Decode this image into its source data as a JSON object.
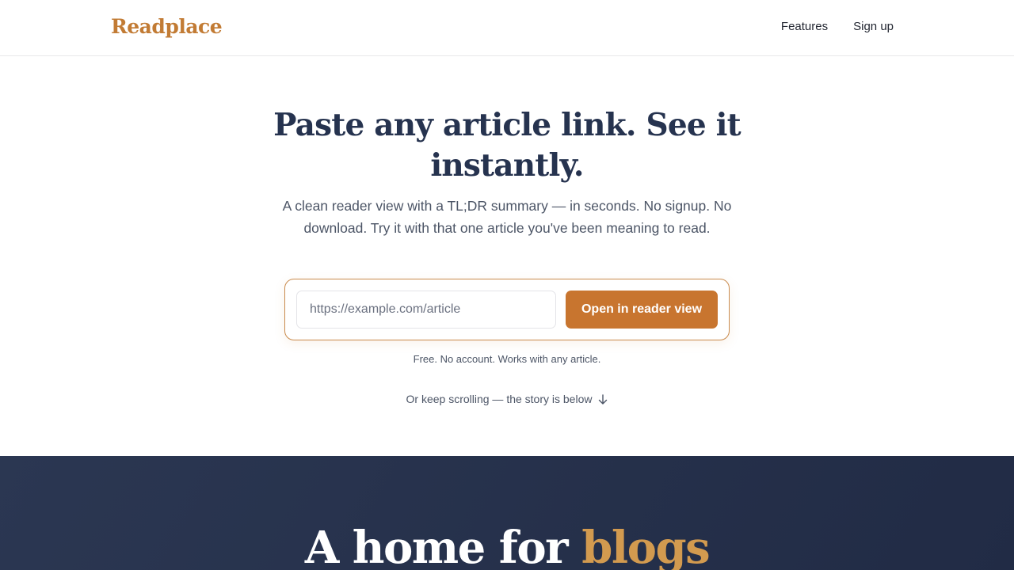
{
  "header": {
    "logo": "Readplace",
    "nav": [
      {
        "label": "Features"
      },
      {
        "label": "Sign up"
      }
    ]
  },
  "hero": {
    "title": "Paste any article link. See it instantly.",
    "subtitle": "A clean reader view with a TL;DR summary — in seconds. No signup. No download. Try it with that one article you've been meaning to read.",
    "input_placeholder": "https://example.com/article",
    "input_value": "",
    "button_label": "Open in reader view",
    "note": "Free. No account. Works with any article.",
    "scroll_hint": "Or keep scrolling — the story is below",
    "scroll_icon": "arrow-down-icon"
  },
  "story": {
    "title_prefix": "A home for ",
    "title_accent": "blogs"
  },
  "colors": {
    "brand": "#c27b34",
    "button": "#c8752f",
    "heading": "#26334f",
    "dark_section": "#26314b",
    "accent_text": "#d29a4f"
  }
}
